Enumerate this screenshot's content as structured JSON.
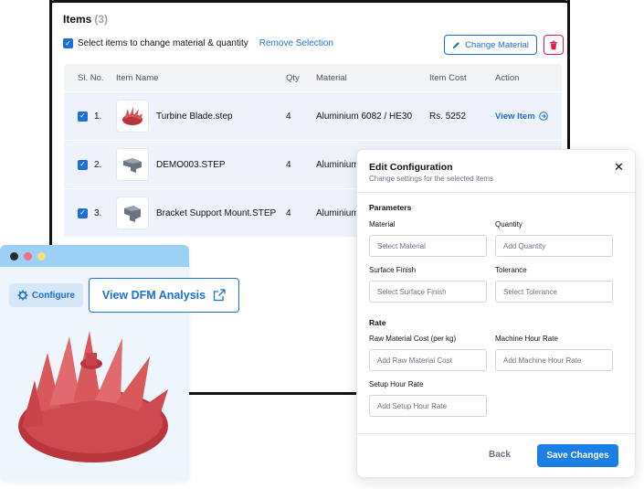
{
  "items_panel": {
    "title": "Items",
    "count": "(3)",
    "select_label": "Select items to change material & quantity",
    "remove_selection": "Remove Selection",
    "change_material": "Change Material",
    "headers": [
      "Sl. No.",
      "Item Name",
      "Qty",
      "Material",
      "Item Cost",
      "Action"
    ],
    "rows": [
      {
        "no": "1.",
        "name": "Turbine Blade.step",
        "qty": "4",
        "material": "Aluminium 6082 / HE30",
        "cost": "Rs. 5252",
        "action": "View Item"
      },
      {
        "no": "2.",
        "name": "DEMO003.STEP",
        "qty": "4",
        "material": "Aluminium",
        "cost": "",
        "action": ""
      },
      {
        "no": "3.",
        "name": "Bracket Support Mount.STEP",
        "qty": "4",
        "material": "Aluminium",
        "cost": "",
        "action": ""
      }
    ]
  },
  "preview": {
    "configure": "Configure",
    "dfm": "View DFM Analysis"
  },
  "modal": {
    "title": "Edit Configuration",
    "subtitle": "Change settings for the selected items",
    "parameters": "Parameters",
    "material_label": "Material",
    "material_placeholder": "Select Material",
    "quantity_label": "Quantity",
    "quantity_placeholder": "Add Quantity",
    "finish_label": "Surface Finish",
    "finish_placeholder": "Select Surface Finish",
    "tolerance_label": "Tolerance",
    "tolerance_placeholder": "Select Tolerance",
    "rate": "Rate",
    "raw_label": "Raw Material Cost (per kg)",
    "raw_placeholder": "Add Raw Material Cost",
    "machine_label": "Machine Hour Rate",
    "machine_placeholder": "Add Machine Hour Rate",
    "setup_label": "Setup Hour Rate",
    "setup_placeholder": "Add Setup Hour Rate",
    "back": "Back",
    "save": "Save Changes"
  },
  "colors": {
    "accent": "#1d6fd6",
    "danger": "#e11d48",
    "row_bg": "#eef3fb",
    "model_red": "#d9585c"
  }
}
